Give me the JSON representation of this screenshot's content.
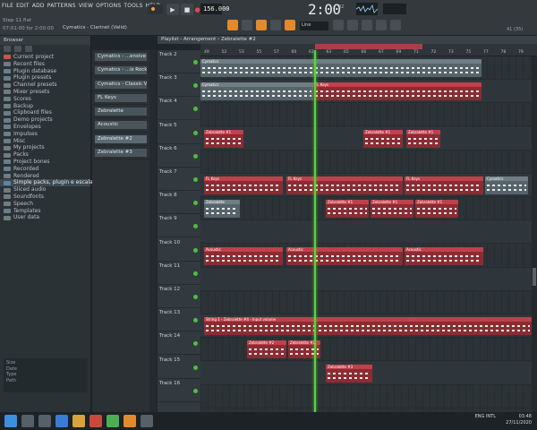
{
  "menu": [
    "FILE",
    "EDIT",
    "ADD",
    "PATTERNS",
    "VIEW",
    "OPTIONS",
    "TOOLS",
    "HELP"
  ],
  "hint": {
    "line1": "Step 11 flat",
    "line2": "07:01:00 for 2:00:00"
  },
  "pattern_selector": "Cymatics - Clarinet (Valid)",
  "tempo": "156.000",
  "time": {
    "main": "2:00",
    "sub": "32"
  },
  "snap": "Line",
  "cpu": "41 (35)",
  "playlist_title": "Playlist - Arrangement › Zebralette #2",
  "browser": {
    "header": "Browser",
    "items": [
      {
        "label": "Current project",
        "icon": "red"
      },
      {
        "label": "Recent files",
        "icon": "grey"
      },
      {
        "label": "Plugin database",
        "icon": "grey"
      },
      {
        "label": "Plugin presets",
        "icon": "grey"
      },
      {
        "label": "Channel presets",
        "icon": "grey"
      },
      {
        "label": "Mixer presets",
        "icon": "grey"
      },
      {
        "label": "Scores",
        "icon": "grey"
      },
      {
        "label": "Backup",
        "icon": "grey"
      },
      {
        "label": "Clipboard files",
        "icon": "grey"
      },
      {
        "label": "Demo projects",
        "icon": "grey"
      },
      {
        "label": "Envelopes",
        "icon": "grey"
      },
      {
        "label": "Impulses",
        "icon": "grey"
      },
      {
        "label": "Misc",
        "icon": "grey"
      },
      {
        "label": "My projects",
        "icon": "grey"
      },
      {
        "label": "Packs",
        "icon": "grey"
      },
      {
        "label": "Project bones",
        "icon": "grey"
      },
      {
        "label": "Recorded",
        "icon": "grey"
      },
      {
        "label": "Rendered",
        "icon": "grey"
      },
      {
        "label": "Simple packs, plugin e escala",
        "icon": "blue"
      },
      {
        "label": "Sliced audio",
        "icon": "grey"
      },
      {
        "label": "Soundfonts",
        "icon": "grey"
      },
      {
        "label": "Speech",
        "icon": "grey"
      },
      {
        "label": "Templates",
        "icon": "grey"
      },
      {
        "label": "User data",
        "icon": "grey"
      }
    ],
    "info": [
      "Size",
      "Date",
      "Type",
      "Path"
    ]
  },
  "patterns": [
    "Cymatics - ...ensive Guit",
    "Cymatics - ...is Rock",
    "Cymatics - Classic Vibe",
    "FL Keys",
    "Zebralette",
    "Acoustic",
    "Zebralette #2",
    "Zebralette #3"
  ],
  "ruler_numbers": [
    "49",
    "52",
    "53",
    "55",
    "57",
    "60",
    "61",
    "63",
    "65",
    "66",
    "67",
    "69",
    "71",
    "72",
    "73",
    "75",
    "77",
    "78",
    "79"
  ],
  "tracks": [
    {
      "name": "Track 2"
    },
    {
      "name": "Track 3"
    },
    {
      "name": "Track 4"
    },
    {
      "name": "Track 5"
    },
    {
      "name": "Track 6"
    },
    {
      "name": "Track 7"
    },
    {
      "name": "Track 8"
    },
    {
      "name": "Track 9"
    },
    {
      "name": "Track 10"
    },
    {
      "name": "Track 11"
    },
    {
      "name": "Track 12"
    },
    {
      "name": "Track 13"
    },
    {
      "name": "Track 14"
    },
    {
      "name": "Track 15"
    },
    {
      "name": "Track 16"
    }
  ],
  "clips": [
    {
      "label": "Cymatics",
      "color": "grey"
    },
    {
      "label": "Zebralette #1",
      "color": "red"
    },
    {
      "label": "FL Keys",
      "color": "red"
    },
    {
      "label": "Zebralette",
      "color": "grey"
    },
    {
      "label": "Acoustic",
      "color": "red"
    },
    {
      "label": "String 1 - Zebralette #4 - Input volume",
      "color": "red"
    },
    {
      "label": "Zebralette #2",
      "color": "red"
    },
    {
      "label": "Zebralette #3",
      "color": "red"
    }
  ],
  "taskbar": {
    "lang": "ENG INTL",
    "clock_time": "03:48",
    "clock_date": "27/11/2020"
  }
}
